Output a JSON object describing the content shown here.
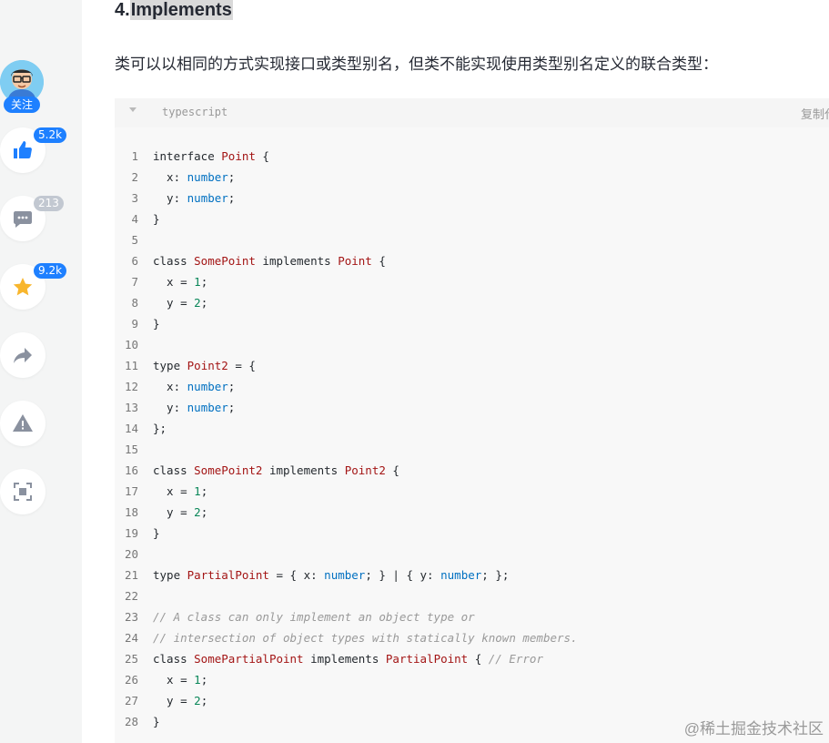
{
  "article": {
    "heading_prefix": "4.",
    "heading_highlight": "Implements",
    "paragraph": "类可以以相同的方式实现接口或类型别名，但类不能实现使用类型别名定义的联合类型："
  },
  "sidebar": {
    "follow_label": "关注",
    "like_count": "5.2k",
    "comment_count": "213",
    "collect_count": "9.2k",
    "colors": {
      "accent": "#1e80ff",
      "muted_badge": "#c2c8d1",
      "star": "#f8b62d",
      "icon_gray": "#8a919f"
    }
  },
  "code": {
    "language": "typescript",
    "copy_label": "复制代",
    "lines": [
      [
        [
          "kw",
          "interface "
        ],
        [
          "ty",
          "Point"
        ],
        [
          "p",
          " {"
        ]
      ],
      [
        [
          "p",
          "  x: "
        ],
        [
          "bt",
          "number"
        ],
        [
          "p",
          ";"
        ]
      ],
      [
        [
          "p",
          "  y: "
        ],
        [
          "bt",
          "number"
        ],
        [
          "p",
          ";"
        ]
      ],
      [
        [
          "p",
          "}"
        ]
      ],
      [],
      [
        [
          "kw",
          "class "
        ],
        [
          "ty",
          "SomePoint"
        ],
        [
          "kw",
          " implements "
        ],
        [
          "ty",
          "Point"
        ],
        [
          "p",
          " {"
        ]
      ],
      [
        [
          "p",
          "  x = "
        ],
        [
          "num",
          "1"
        ],
        [
          "p",
          ";"
        ]
      ],
      [
        [
          "p",
          "  y = "
        ],
        [
          "num",
          "2"
        ],
        [
          "p",
          ";"
        ]
      ],
      [
        [
          "p",
          "}"
        ]
      ],
      [],
      [
        [
          "kw",
          "type "
        ],
        [
          "ty",
          "Point2"
        ],
        [
          "p",
          " = {"
        ]
      ],
      [
        [
          "p",
          "  x: "
        ],
        [
          "bt",
          "number"
        ],
        [
          "p",
          ";"
        ]
      ],
      [
        [
          "p",
          "  y: "
        ],
        [
          "bt",
          "number"
        ],
        [
          "p",
          ";"
        ]
      ],
      [
        [
          "p",
          "};"
        ]
      ],
      [],
      [
        [
          "kw",
          "class "
        ],
        [
          "ty",
          "SomePoint2"
        ],
        [
          "kw",
          " implements "
        ],
        [
          "ty",
          "Point2"
        ],
        [
          "p",
          " {"
        ]
      ],
      [
        [
          "p",
          "  x = "
        ],
        [
          "num",
          "1"
        ],
        [
          "p",
          ";"
        ]
      ],
      [
        [
          "p",
          "  y = "
        ],
        [
          "num",
          "2"
        ],
        [
          "p",
          ";"
        ]
      ],
      [
        [
          "p",
          "}"
        ]
      ],
      [],
      [
        [
          "kw",
          "type "
        ],
        [
          "ty",
          "PartialPoint"
        ],
        [
          "p",
          " = { x: "
        ],
        [
          "bt",
          "number"
        ],
        [
          "p",
          "; } | { y: "
        ],
        [
          "bt",
          "number"
        ],
        [
          "p",
          "; };"
        ]
      ],
      [],
      [
        [
          "cm",
          "// A class can only implement an object type or"
        ]
      ],
      [
        [
          "cm",
          "// intersection of object types with statically known members."
        ]
      ],
      [
        [
          "kw",
          "class "
        ],
        [
          "ty",
          "SomePartialPoint"
        ],
        [
          "kw",
          " implements "
        ],
        [
          "ty",
          "PartialPoint"
        ],
        [
          "p",
          " { "
        ],
        [
          "cm",
          "// Error"
        ]
      ],
      [
        [
          "p",
          "  x = "
        ],
        [
          "num",
          "1"
        ],
        [
          "p",
          ";"
        ]
      ],
      [
        [
          "p",
          "  y = "
        ],
        [
          "num",
          "2"
        ],
        [
          "p",
          ";"
        ]
      ],
      [
        [
          "p",
          "}"
        ]
      ]
    ]
  },
  "watermark": "@稀土掘金技术社区"
}
